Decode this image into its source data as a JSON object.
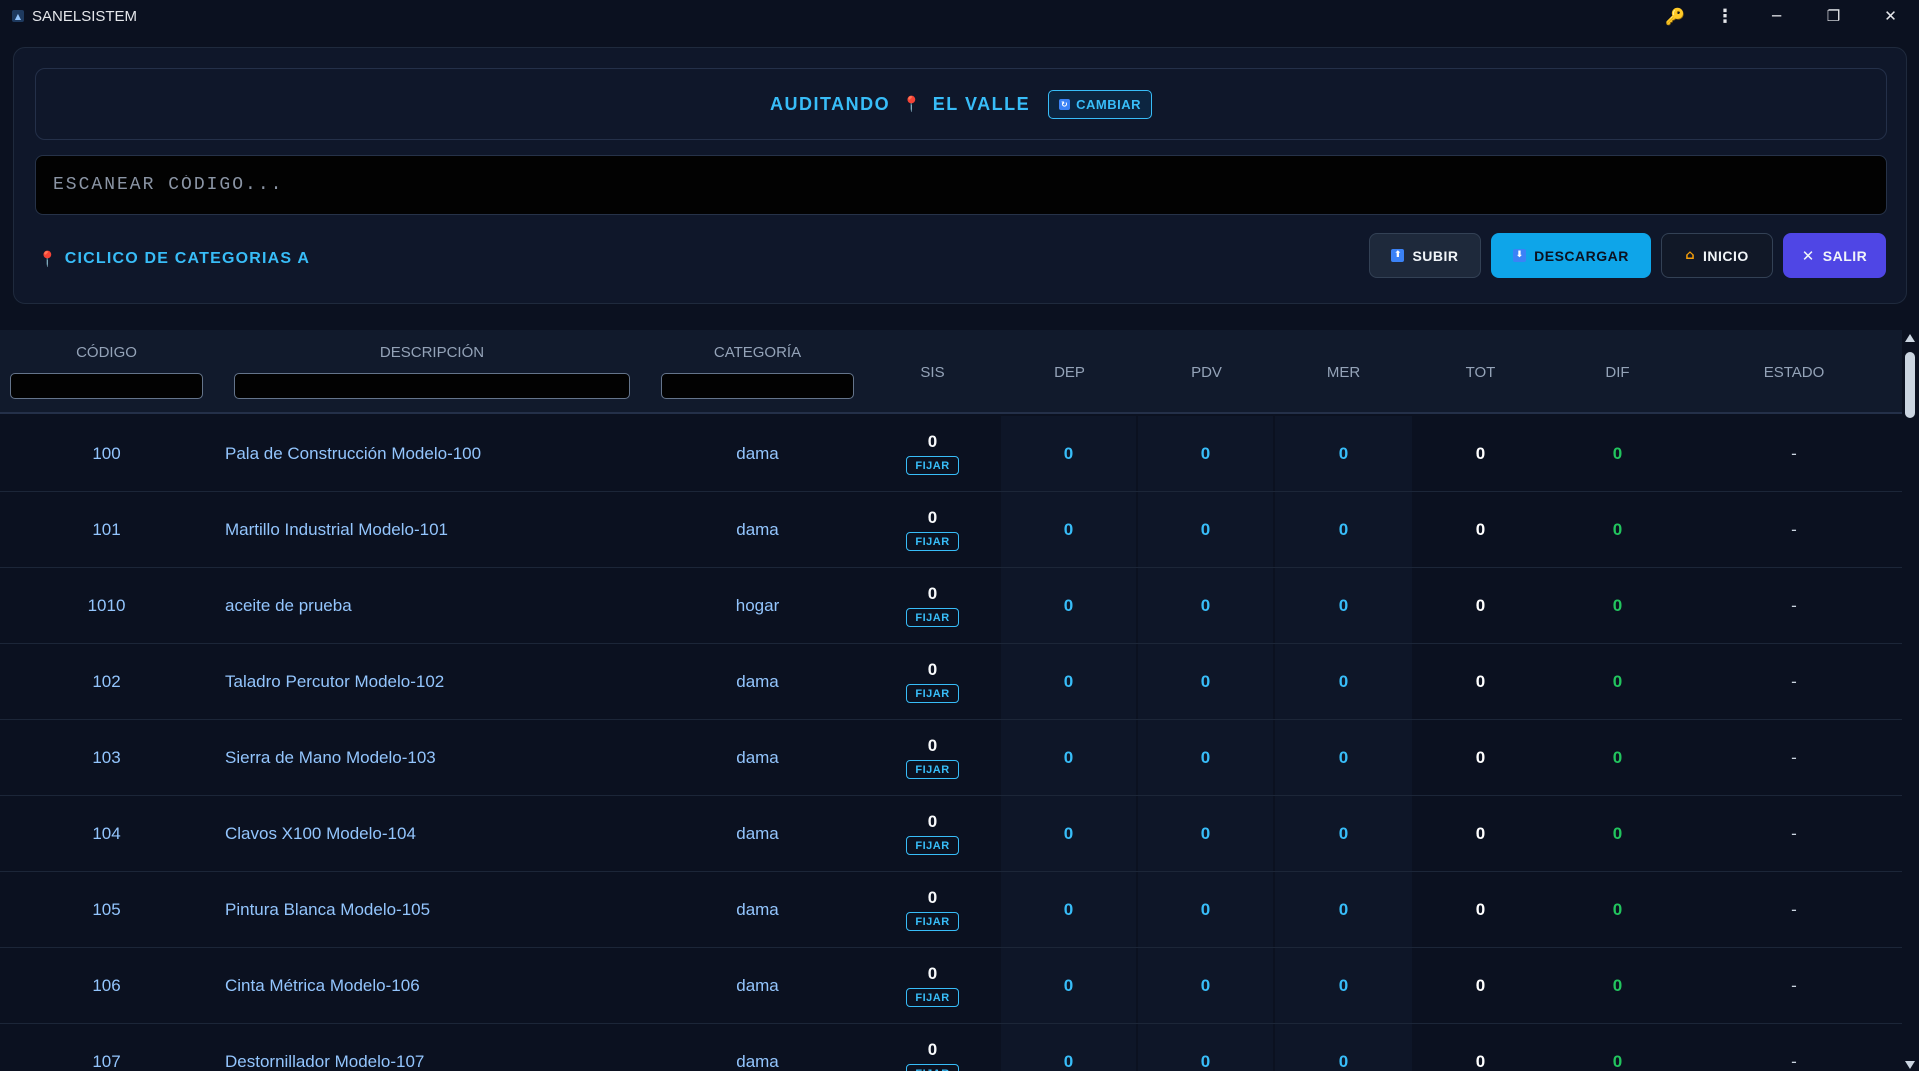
{
  "window": {
    "title": "SANELSISTEM",
    "app_icon": "app-logo-icon",
    "key_icon": "🔑",
    "more_icon": "⋮",
    "minimize_icon": "─",
    "maximize_icon": "❐",
    "close_icon": "✕"
  },
  "header": {
    "audit_label": "AUDITANDO",
    "location_pin": "📍",
    "location": "EL VALLE",
    "change_label": "CAMBIAR",
    "scan_placeholder": "ESCANEAR CÓDIGO...",
    "cycle_pin": "📍",
    "cycle_label": "CICLICO DE CATEGORIAS A"
  },
  "actions": {
    "subir": "SUBIR",
    "descargar": "DESCARGAR",
    "inicio": "INICIO",
    "salir": "SALIR"
  },
  "table": {
    "columns": [
      "CÓDIGO",
      "DESCRIPCIÓN",
      "CATEGORÍA",
      "SIS",
      "DEP",
      "PDV",
      "MER",
      "TOT",
      "DIF",
      "ESTADO"
    ],
    "fix_label": "FIJAR",
    "rows": [
      {
        "code": "100",
        "desc": "Pala de Construcción Modelo-100",
        "cat": "dama",
        "sis": "0",
        "dep": "0",
        "pdv": "0",
        "mer": "0",
        "tot": "0",
        "dif": "0",
        "estado": "-"
      },
      {
        "code": "101",
        "desc": "Martillo Industrial Modelo-101",
        "cat": "dama",
        "sis": "0",
        "dep": "0",
        "pdv": "0",
        "mer": "0",
        "tot": "0",
        "dif": "0",
        "estado": "-"
      },
      {
        "code": "1010",
        "desc": "aceite de prueba",
        "cat": "hogar",
        "sis": "0",
        "dep": "0",
        "pdv": "0",
        "mer": "0",
        "tot": "0",
        "dif": "0",
        "estado": "-"
      },
      {
        "code": "102",
        "desc": "Taladro Percutor Modelo-102",
        "cat": "dama",
        "sis": "0",
        "dep": "0",
        "pdv": "0",
        "mer": "0",
        "tot": "0",
        "dif": "0",
        "estado": "-"
      },
      {
        "code": "103",
        "desc": "Sierra de Mano Modelo-103",
        "cat": "dama",
        "sis": "0",
        "dep": "0",
        "pdv": "0",
        "mer": "0",
        "tot": "0",
        "dif": "0",
        "estado": "-"
      },
      {
        "code": "104",
        "desc": "Clavos X100 Modelo-104",
        "cat": "dama",
        "sis": "0",
        "dep": "0",
        "pdv": "0",
        "mer": "0",
        "tot": "0",
        "dif": "0",
        "estado": "-"
      },
      {
        "code": "105",
        "desc": "Pintura Blanca Modelo-105",
        "cat": "dama",
        "sis": "0",
        "dep": "0",
        "pdv": "0",
        "mer": "0",
        "tot": "0",
        "dif": "0",
        "estado": "-"
      },
      {
        "code": "106",
        "desc": "Cinta Métrica Modelo-106",
        "cat": "dama",
        "sis": "0",
        "dep": "0",
        "pdv": "0",
        "mer": "0",
        "tot": "0",
        "dif": "0",
        "estado": "-"
      },
      {
        "code": "107",
        "desc": "Destornillador Modelo-107",
        "cat": "dama",
        "sis": "0",
        "dep": "0",
        "pdv": "0",
        "mer": "0",
        "tot": "0",
        "dif": "0",
        "estado": "-"
      }
    ]
  },
  "colors": {
    "background": "#0b1120",
    "accent": "#38bdf8",
    "diff_ok": "#22c55e",
    "salir": "#4f46e5"
  }
}
